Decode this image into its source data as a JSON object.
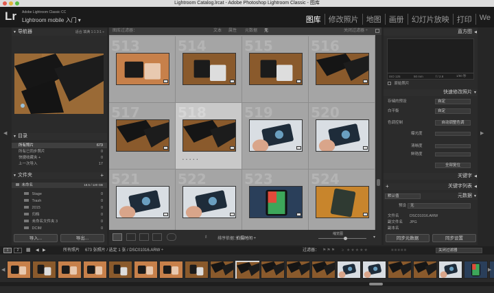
{
  "window": {
    "title": "Lightroom Catalog.lrcat - Adobe Photoshop Lightroom Classic - 图库"
  },
  "identity": {
    "logo": "Lr",
    "product": "Adobe Lightroom Classic CC",
    "mobile": "Lightroom mobile 入门 ▾"
  },
  "modules": [
    "图库",
    "修改照片",
    "地图",
    "画册",
    "幻灯片放映",
    "打印",
    "We"
  ],
  "navigator": {
    "title": "导航器",
    "zoom": [
      "适合",
      "填满",
      "1:1",
      "3:1 ÷"
    ]
  },
  "catalog": {
    "title": "目录",
    "items": [
      {
        "label": "所有照片",
        "count": "673"
      },
      {
        "label": "所有已同步照片",
        "count": "0"
      },
      {
        "label": "快捷收藏夹 +",
        "count": "0"
      },
      {
        "label": "上一次导入",
        "count": "17"
      }
    ]
  },
  "folders": {
    "title": "文件夹",
    "volume": "未命名",
    "volume_info": "18.5 / 120 GB",
    "items": [
      {
        "label": "Stage",
        "count": "0"
      },
      {
        "label": "Trash",
        "count": "0"
      },
      {
        "label": "2015",
        "count": "0"
      },
      {
        "label": "归档",
        "count": "0"
      },
      {
        "label": "未命名文件夹 3",
        "count": "0"
      },
      {
        "label": "DCIM",
        "count": "0"
      }
    ]
  },
  "left_buttons": {
    "import": "导入...",
    "export": "导出..."
  },
  "filter_bar": {
    "title": "图库过滤器：",
    "tabs": [
      "文本",
      "属性",
      "元数据",
      "无"
    ],
    "preset": "关闭过滤器 ÷"
  },
  "grid": {
    "cells": [
      {
        "num": "513",
        "img": "a"
      },
      {
        "num": "514",
        "img": "b"
      },
      {
        "num": "515",
        "img": "b"
      },
      {
        "num": "516",
        "img": "c"
      },
      {
        "num": "517",
        "img": "c"
      },
      {
        "num": "518",
        "img": "c"
      },
      {
        "num": "519",
        "img": "d"
      },
      {
        "num": "520",
        "img": "d"
      },
      {
        "num": "521",
        "img": "d"
      },
      {
        "num": "522",
        "img": "d"
      },
      {
        "num": "523",
        "img": "e"
      },
      {
        "num": "524",
        "img": "f"
      }
    ],
    "selected_index": 5,
    "dots": "• • • • •"
  },
  "toolbar": {
    "sort_label": "排序依据：",
    "sort_value": "拍摄时间 ÷",
    "thumb_label": "缩览图"
  },
  "histogram": {
    "title": "直方图",
    "iso": "ISO 125",
    "focal": "50 mm",
    "fstop": "f / 2.8",
    "shutter": "1/60 秒",
    "original": "原始照片"
  },
  "quick_develop": {
    "title": "快速修改照片",
    "rows": [
      {
        "label": "存储的预设",
        "value": "自定"
      },
      {
        "label": "白平衡",
        "value": "自定"
      },
      {
        "label": "色调控制",
        "value": "自动调整色调"
      }
    ],
    "sliders": [
      "曝光度",
      "清晰度",
      "鲜艳度"
    ],
    "reset": "全部复位"
  },
  "keywords": {
    "title": "关键字",
    "list_title": "关键字列表"
  },
  "metadata": {
    "title": "元数据",
    "preset": "默认值",
    "preset_label": "预设",
    "preset_value": "无",
    "file_label": "文件名",
    "file_value": "DSC01016.ARW",
    "type_label": "副文件名",
    "type_value": "JPG",
    "folder_label": "副本名"
  },
  "right_buttons": {
    "sync_meta": "同步元数据",
    "sync_settings": "同步设置"
  },
  "filmstrip_bar": {
    "pages": [
      "1",
      "2"
    ],
    "source": "所有照片",
    "info": "673 张照片 / 选定 1 张 / DSC01016.ARW ÷",
    "filter_label": "过滤器：",
    "filter_value": "关闭过滤器"
  },
  "filmstrip": {
    "items": [
      "a",
      "b",
      "a",
      "a",
      "b",
      "a",
      "a",
      "b",
      "c",
      "c",
      "c",
      "c",
      "c",
      "d",
      "d",
      "c",
      "c",
      "d",
      "e",
      "e",
      "e",
      "d",
      "c",
      "c",
      "d",
      "f"
    ],
    "selected_index": 9
  }
}
